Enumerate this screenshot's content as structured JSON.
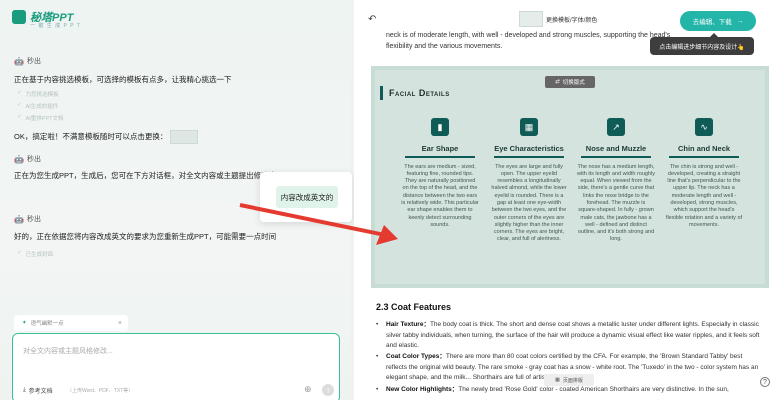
{
  "app": {
    "logo_text": "秘塔PPT",
    "logo_sub": "一 键 生 成 P P T"
  },
  "chat": {
    "bot_name": "秒出",
    "msg1": "正在基于内容挑选模板，可选择的模板有点多，让我精心挑选一下",
    "steps": [
      "为您挑选模板",
      "AI生成的插件",
      "AI重排PPT文档"
    ],
    "msg2": "OK，搞定啦！不满意模板随时可以点击更换：",
    "msg3": "正在为您生成PPT，生成后，您可在下方对话框，对全文内容或主题提出修改意见",
    "msg4": "好的，正在依据您将内容改成英文的要求为您重新生成PPT，可能需要一点时间",
    "step_last": "已生成封面"
  },
  "popup": {
    "button_label": "内容改成英文的"
  },
  "input": {
    "tag_label": "语气幽默一点",
    "placeholder": "对全文内容或主题风格修改...",
    "attach_label": "参考文档",
    "attach_hint": "（上传Word、PDF、TXT等）"
  },
  "toolbar": {
    "template_label": "更换模板/字体/颜色",
    "edit_button": "去编辑、下载",
    "tooltip": "点击编辑进步细节内容及设计👆"
  },
  "doc": {
    "para_top": "neck is of moderate length, with well - developed and strong muscles, supporting the head's flexibility and the various movements.",
    "slide": {
      "switch_label": "切换版式",
      "title": "Facial Details",
      "columns": [
        {
          "icon": "bar-chart-icon",
          "title": "Ear Shape",
          "body": "The ears are medium - sized, featuring fine, rounded tips. They are naturally positioned on the top of the head, and the distance between the two ears is relatively wide. This particular ear shape enables them to keenly detect surrounding sounds."
        },
        {
          "icon": "calculator-icon",
          "title": "Eye Characteristics",
          "body": "The eyes are large and fully open. The upper eyelid resembles a longitudinally halved almond, while the lower eyelid is rounded. There is a gap at least one eye-width between the two eyes, and the outer corners of the eyes are slightly higher than the inner corners. The eyes are bright, clear, and full of alertness."
        },
        {
          "icon": "trend-icon",
          "title": "Nose and Muzzle",
          "body": "The nose has a medium length, with its length and width roughly equal. When viewed from the side, there's a gentle curve that links the nose bridge to the forehead. The muzzle is square-shaped. In fully - grown male cats, the jawbone has a well - defined and distinct outline, and it's both strong and long."
        },
        {
          "icon": "wave-icon",
          "title": "Chin and Neck",
          "body": "The chin is strong and well - developed, creating a straight line that's perpendicular to the upper lip. The neck has a moderate length and well - developed, strong muscles, which support the head's flexible rotation and a variety of movements."
        }
      ]
    },
    "section_heading": "2.3 Coat Features",
    "bullets": [
      {
        "label": "Hair Texture",
        "text": "The body coat is thick. The short and dense coat shows a metallic luster under different lights. Especially in classic silver tabby individuals, when turning, the surface of the hair will produce a dynamic visual effect like water ripples, and it feels soft and elastic."
      },
      {
        "label": "Coat Color Types",
        "text": "There are more than 80 coat colors certified by the CFA. For example, the 'Brown Standard Tabby' best reflects the original wild beauty. The rare smoke - gray coat has a snow - white root. The 'Tuxedo' in the two - color system has an elegant shape, and the milk... Shorthairs are full of artistic sense."
      },
      {
        "label": "New Color Highlights",
        "text": "The newly bred 'Rose Gold' color - coated American Shorthairs are very distinctive. In the sun,"
      }
    ],
    "page_pill": "页面排版"
  }
}
